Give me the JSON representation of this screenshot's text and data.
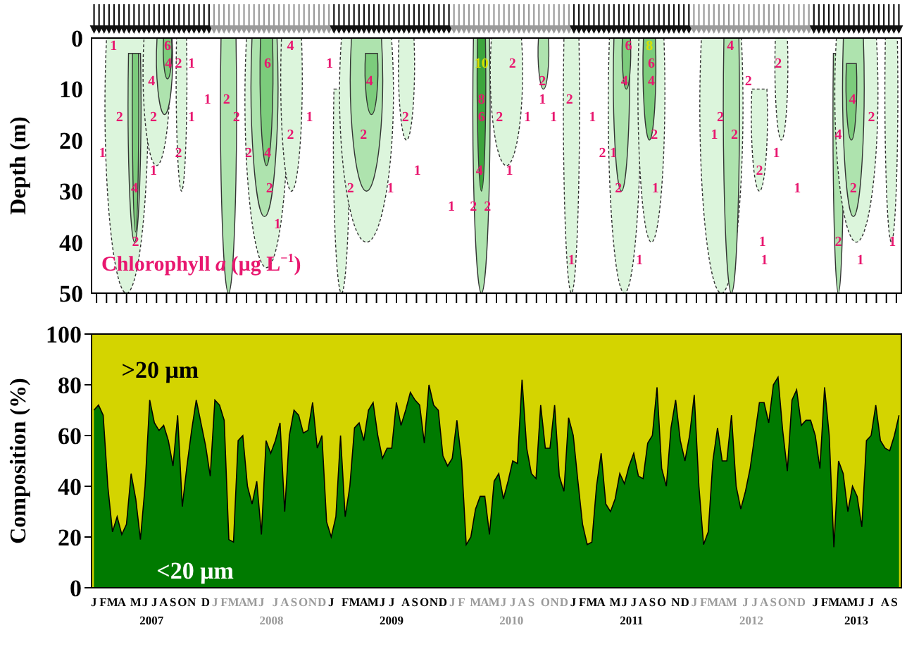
{
  "depth_plot": {
    "ylabel": "Depth (m)",
    "yticks": [
      "0",
      "10",
      "20",
      "30",
      "40",
      "50"
    ],
    "legend": "Chlorophyll *a* (µg L$^{−1}$)",
    "contour_labels": [
      {
        "text": "1",
        "emphasized": false
      },
      {
        "text": "6",
        "emphasized": false
      },
      {
        "text": "4",
        "emphasized": false
      },
      {
        "text": "6",
        "emphasized": false
      },
      {
        "text": "8",
        "emphasized": true
      },
      {
        "text": "4",
        "emphasized": false
      },
      {
        "text": "4",
        "emphasized": false
      },
      {
        "text": "2",
        "emphasized": false
      },
      {
        "text": "1",
        "emphasized": false
      },
      {
        "text": "6",
        "emphasized": false
      },
      {
        "text": "1",
        "emphasized": false
      },
      {
        "text": "10",
        "emphasized": true
      },
      {
        "text": "2",
        "emphasized": false
      },
      {
        "text": "6",
        "emphasized": false
      },
      {
        "text": "2",
        "emphasized": false
      },
      {
        "text": "4",
        "emphasized": false
      },
      {
        "text": "4",
        "emphasized": false
      },
      {
        "text": "2",
        "emphasized": false
      },
      {
        "text": "4",
        "emphasized": false
      },
      {
        "text": "4",
        "emphasized": false
      },
      {
        "text": "2",
        "emphasized": false
      },
      {
        "text": "1",
        "emphasized": false
      },
      {
        "text": "2",
        "emphasized": false
      },
      {
        "text": "8",
        "emphasized": false
      },
      {
        "text": "1",
        "emphasized": false
      },
      {
        "text": "2",
        "emphasized": false
      },
      {
        "text": "4",
        "emphasized": false
      },
      {
        "text": "2",
        "emphasized": false
      },
      {
        "text": "2",
        "emphasized": false
      },
      {
        "text": "1",
        "emphasized": false
      },
      {
        "text": "2",
        "emphasized": false
      },
      {
        "text": "1",
        "emphasized": false
      },
      {
        "text": "2",
        "emphasized": false
      },
      {
        "text": "6",
        "emphasized": false
      },
      {
        "text": "2",
        "emphasized": false
      },
      {
        "text": "1",
        "emphasized": false
      },
      {
        "text": "1",
        "emphasized": false
      },
      {
        "text": "1",
        "emphasized": false
      },
      {
        "text": "2",
        "emphasized": false
      },
      {
        "text": "2",
        "emphasized": false
      },
      {
        "text": "2",
        "emphasized": false
      },
      {
        "text": "2",
        "emphasized": false
      },
      {
        "text": "2",
        "emphasized": false
      },
      {
        "text": "1",
        "emphasized": false
      },
      {
        "text": "2",
        "emphasized": false
      },
      {
        "text": "4",
        "emphasized": false
      },
      {
        "text": "1",
        "emphasized": false
      },
      {
        "text": "2",
        "emphasized": false
      },
      {
        "text": "2",
        "emphasized": false
      },
      {
        "text": "4",
        "emphasized": false
      },
      {
        "text": "2",
        "emphasized": false
      },
      {
        "text": "1",
        "emphasized": false
      },
      {
        "text": "1",
        "emphasized": false
      },
      {
        "text": "1",
        "emphasized": false
      },
      {
        "text": "1",
        "emphasized": false
      },
      {
        "text": "4",
        "emphasized": false
      },
      {
        "text": "1",
        "emphasized": false
      },
      {
        "text": "2",
        "emphasized": false
      },
      {
        "text": "4",
        "emphasized": false
      },
      {
        "text": "2",
        "emphasized": false
      },
      {
        "text": "2",
        "emphasized": false
      },
      {
        "text": "1",
        "emphasized": false
      },
      {
        "text": "2",
        "emphasized": false
      },
      {
        "text": "1",
        "emphasized": false
      },
      {
        "text": "1",
        "emphasized": false
      },
      {
        "text": "2",
        "emphasized": false
      },
      {
        "text": "1",
        "emphasized": false
      },
      {
        "text": "2",
        "emphasized": false
      },
      {
        "text": "2",
        "emphasized": false
      },
      {
        "text": "1",
        "emphasized": false
      },
      {
        "text": "2",
        "emphasized": false
      },
      {
        "text": "1",
        "emphasized": false
      },
      {
        "text": "2",
        "emphasized": false
      },
      {
        "text": "1",
        "emphasized": false
      },
      {
        "text": "1",
        "emphasized": false
      },
      {
        "text": "1",
        "emphasized": false
      },
      {
        "text": "1",
        "emphasized": false
      },
      {
        "text": "1",
        "emphasized": false
      }
    ]
  },
  "composition": {
    "chart_data": {
      "type": "area",
      "ylabel": "Composition (%)",
      "ylim": [
        0,
        100
      ],
      "yticks": [
        0,
        20,
        40,
        60,
        80,
        100
      ],
      "stacked": true,
      "categories": [
        "J",
        null,
        "F",
        null,
        "M",
        null,
        "A",
        null,
        null,
        "M",
        null,
        "J",
        null,
        "J",
        null,
        "A",
        null,
        "S",
        null,
        "O",
        null,
        "N",
        null,
        null,
        "D",
        null,
        "J",
        null,
        "F",
        null,
        "M",
        null,
        "A",
        null,
        "M",
        null,
        "J",
        null,
        null,
        "J",
        null,
        "A",
        null,
        "S",
        null,
        "O",
        null,
        "N",
        null,
        "D",
        null,
        "J",
        null,
        null,
        "F",
        null,
        "M",
        null,
        "A",
        null,
        "M",
        null,
        "J",
        null,
        "J",
        null,
        null,
        "A",
        null,
        "S",
        null,
        "O",
        null,
        "N",
        null,
        "D",
        null,
        "J",
        null,
        "F",
        null,
        null,
        "M",
        null,
        "A",
        null,
        "M",
        null,
        "J",
        null,
        "J",
        null,
        "A",
        null,
        "S",
        null,
        null,
        "O",
        null,
        "N",
        null,
        "D",
        null,
        "J",
        null,
        "F",
        null,
        "M",
        null,
        "A",
        null,
        null,
        "M",
        null,
        "J",
        null,
        "J",
        null,
        "A",
        null,
        "S",
        null,
        "O",
        null,
        null,
        "N",
        null,
        "D",
        null,
        "J",
        null,
        "F",
        null,
        "M",
        null,
        "A",
        null,
        "M",
        null,
        null,
        "J",
        null,
        "J",
        null,
        "A",
        null,
        "S",
        null,
        "O",
        null,
        "N",
        null,
        "D",
        null,
        null,
        "J",
        null,
        "F",
        null,
        "M",
        null,
        "A",
        null,
        "M",
        null,
        "J",
        null,
        "J",
        null,
        null,
        "A",
        null,
        "S",
        null
      ],
      "series": [
        {
          "name": "<20 μm",
          "color": "#007a00",
          "values": [
            70,
            72,
            68,
            40,
            22,
            28,
            21,
            25,
            45,
            35,
            19,
            40,
            74,
            65,
            62,
            64,
            58,
            48,
            68,
            32,
            48,
            62,
            74,
            65,
            56,
            44,
            74,
            72,
            66,
            19,
            18,
            58,
            60,
            40,
            33,
            42,
            21,
            58,
            53,
            58,
            65,
            30,
            60,
            70,
            68,
            61,
            62,
            73,
            55,
            60,
            26,
            20,
            28,
            60,
            28,
            40,
            63,
            65,
            58,
            70,
            73,
            60,
            51,
            55,
            55,
            73,
            64,
            70,
            77,
            74,
            72,
            57,
            80,
            72,
            70,
            52,
            48,
            51,
            66,
            50,
            17,
            20,
            31,
            36,
            36,
            21,
            42,
            45,
            35,
            42,
            50,
            49,
            82,
            55,
            45,
            43,
            72,
            55,
            55,
            72,
            44,
            38,
            67,
            60,
            42,
            25,
            17,
            18,
            40,
            53,
            33,
            30,
            35,
            45,
            41,
            48,
            53,
            44,
            43,
            57,
            60,
            79,
            47,
            40,
            63,
            74,
            58,
            50,
            60,
            76,
            40,
            17,
            22,
            50,
            63,
            50,
            50,
            68,
            40,
            31,
            38,
            47,
            60,
            73,
            73,
            65,
            80,
            83,
            62,
            46,
            74,
            78,
            64,
            66,
            66,
            60,
            47,
            79,
            60,
            16,
            50,
            45,
            30,
            40,
            36,
            24,
            58,
            60,
            72,
            58,
            55,
            54,
            60,
            68
          ]
        }
      ],
      "annotations": [
        {
          "text": ">20 μm"
        }
      ]
    }
  },
  "years": [
    {
      "label": "2007",
      "muted": false
    },
    {
      "label": "2008",
      "muted": true
    },
    {
      "label": "2009",
      "muted": false
    },
    {
      "label": "2010",
      "muted": true
    },
    {
      "label": "2011",
      "muted": false
    },
    {
      "label": "2012",
      "muted": true
    },
    {
      "label": "2013",
      "muted": false
    }
  ]
}
